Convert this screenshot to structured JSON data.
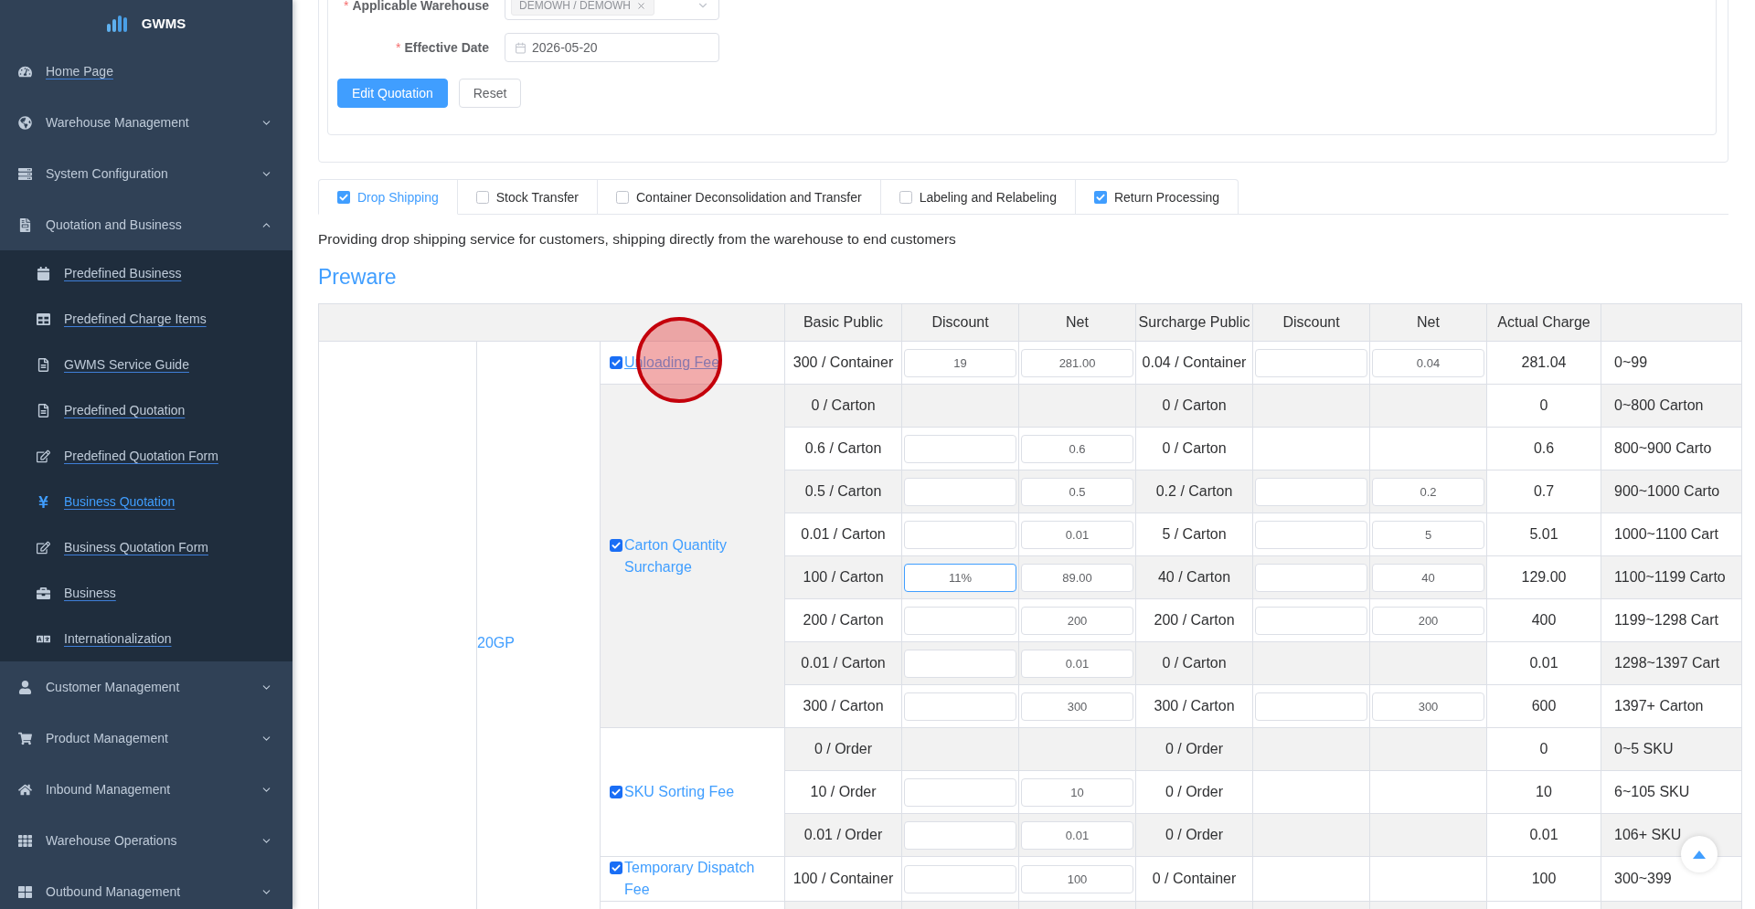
{
  "sidebar": {
    "logo": "GWMS",
    "items": [
      {
        "label": "Home Page"
      },
      {
        "label": "Warehouse Management",
        "expanded": false
      },
      {
        "label": "System Configuration",
        "expanded": false
      },
      {
        "label": "Quotation and Business",
        "expanded": true,
        "children": [
          {
            "label": "Predefined Business",
            "selected": false
          },
          {
            "label": "Predefined Charge Items",
            "selected": false
          },
          {
            "label": "GWMS Service Guide",
            "selected": false
          },
          {
            "label": "Predefined Quotation",
            "selected": false
          },
          {
            "label": "Predefined Quotation Form",
            "selected": false
          },
          {
            "label": "Business Quotation",
            "selected": true
          },
          {
            "label": "Business Quotation Form",
            "selected": false
          },
          {
            "label": "Business",
            "selected": false
          },
          {
            "label": "Internationalization",
            "selected": false
          }
        ]
      },
      {
        "label": "Customer Management",
        "expanded": false
      },
      {
        "label": "Product Management",
        "expanded": false
      },
      {
        "label": "Inbound Management",
        "expanded": false
      },
      {
        "label": "Warehouse Operations",
        "expanded": false
      },
      {
        "label": "Outbound Management",
        "expanded": false
      }
    ]
  },
  "form": {
    "fields": [
      {
        "kind": "select",
        "required_mark": "*",
        "label": "Applicable Warehouse",
        "tags": [
          "DEMOWH / DEMOWH"
        ]
      },
      {
        "kind": "date",
        "required_mark": "*",
        "label": "Effective Date",
        "value": "2026-05-20"
      }
    ],
    "buttons": [
      {
        "kind": "primary",
        "label": "Edit Quotation"
      },
      {
        "kind": "default",
        "label": "Reset"
      }
    ]
  },
  "tabs": [
    {
      "label": "Drop Shipping",
      "selected": true,
      "checked": true
    },
    {
      "label": "Stock Transfer",
      "selected": false,
      "checked": false
    },
    {
      "label": "Container Deconsolidation and Transfer",
      "selected": false,
      "checked": false
    },
    {
      "label": "Labeling and Relabeling",
      "selected": false,
      "checked": false
    },
    {
      "label": "Return Processing",
      "selected": false,
      "checked": true
    }
  ],
  "description": "Providing drop shipping service for customers, shipping directly from the warehouse to end customers",
  "section_title": "Preware",
  "table": {
    "columns": [
      "Basic Public",
      "Discount",
      "Net",
      "Surcharge Public",
      "Discount",
      "Net",
      "Actual Charge"
    ],
    "container": "20GP",
    "groups": [
      {
        "name": "Unloading Fee",
        "checked": true,
        "hovered": true,
        "highlighted": false,
        "rows": [
          {
            "basic_public": "300 / Container",
            "discount": {
              "value": "19",
              "focused": false
            },
            "net": {
              "value": "281.00",
              "focused": false
            },
            "surcharge_public": "0.04 / Container",
            "surcharge_discount": {
              "focused": false
            },
            "surcharge_net": {
              "value": "0.04",
              "focused": false
            },
            "actual_charge": "281.04",
            "range": "0~99"
          }
        ]
      },
      {
        "name": "Carton Quantity Surcharge",
        "checked": true,
        "hovered": false,
        "highlighted": true,
        "rows": [
          {
            "basic_public": "0 / Carton",
            "surcharge_public": "0 / Carton",
            "actual_charge": "0",
            "range": "0~800 Carton"
          },
          {
            "basic_public": "0.6 / Carton",
            "discount": {
              "focused": false
            },
            "net": {
              "value": "0.6",
              "focused": false
            },
            "surcharge_public": "0 / Carton",
            "actual_charge": "0.6",
            "range": "800~900 Carto"
          },
          {
            "basic_public": "0.5 / Carton",
            "discount": {
              "focused": false
            },
            "net": {
              "value": "0.5",
              "focused": false
            },
            "surcharge_public": "0.2 / Carton",
            "surcharge_discount": {
              "focused": false
            },
            "surcharge_net": {
              "value": "0.2",
              "focused": false
            },
            "actual_charge": "0.7",
            "range": "900~1000 Carto"
          },
          {
            "basic_public": "0.01 / Carton",
            "discount": {
              "focused": false
            },
            "net": {
              "value": "0.01",
              "focused": false
            },
            "surcharge_public": "5 / Carton",
            "surcharge_discount": {
              "focused": false
            },
            "surcharge_net": {
              "value": "5",
              "focused": false
            },
            "actual_charge": "5.01",
            "range": "1000~1100 Cart"
          },
          {
            "basic_public": "100 / Carton",
            "discount": {
              "value": "11%",
              "focused": true
            },
            "net": {
              "value": "89.00",
              "focused": false
            },
            "surcharge_public": "40 / Carton",
            "surcharge_discount": {
              "focused": false
            },
            "surcharge_net": {
              "value": "40",
              "focused": false
            },
            "actual_charge": "129.00",
            "range": "1100~1199 Carto"
          },
          {
            "basic_public": "200 / Carton",
            "discount": {
              "focused": false
            },
            "net": {
              "value": "200",
              "focused": false
            },
            "surcharge_public": "200 / Carton",
            "surcharge_discount": {
              "focused": false
            },
            "surcharge_net": {
              "value": "200",
              "focused": false
            },
            "actual_charge": "400",
            "range": "1199~1298 Cart"
          },
          {
            "basic_public": "0.01 / Carton",
            "discount": {
              "focused": false
            },
            "net": {
              "value": "0.01",
              "focused": false
            },
            "surcharge_public": "0 / Carton",
            "actual_charge": "0.01",
            "range": "1298~1397 Cart"
          },
          {
            "basic_public": "300 / Carton",
            "discount": {
              "focused": false
            },
            "net": {
              "value": "300",
              "focused": false
            },
            "surcharge_public": "300 / Carton",
            "surcharge_discount": {
              "focused": false
            },
            "surcharge_net": {
              "value": "300",
              "focused": false
            },
            "actual_charge": "600",
            "range": "1397+ Carton"
          }
        ]
      },
      {
        "name": "SKU Sorting Fee",
        "checked": true,
        "hovered": false,
        "highlighted": false,
        "rows": [
          {
            "basic_public": "0 / Order",
            "surcharge_public": "0 / Order",
            "actual_charge": "0",
            "range": "0~5 SKU"
          },
          {
            "basic_public": "10 / Order",
            "discount": {
              "focused": false
            },
            "net": {
              "value": "10",
              "focused": false
            },
            "surcharge_public": "0 / Order",
            "actual_charge": "10",
            "range": "6~105 SKU"
          },
          {
            "basic_public": "0.01 / Order",
            "discount": {
              "focused": false
            },
            "net": {
              "value": "0.01",
              "focused": false
            },
            "surcharge_public": "0 / Order",
            "actual_charge": "0.01",
            "range": "106+ SKU"
          }
        ]
      },
      {
        "name": "Temporary Dispatch Fee",
        "checked": true,
        "hovered": false,
        "highlighted": false,
        "rows": [
          {
            "basic_public": "100 / Container",
            "discount": {
              "focused": false
            },
            "net": {
              "value": "100",
              "focused": false
            },
            "surcharge_public": "0 / Container",
            "actual_charge": "100",
            "range": "300~399"
          }
        ]
      }
    ]
  }
}
